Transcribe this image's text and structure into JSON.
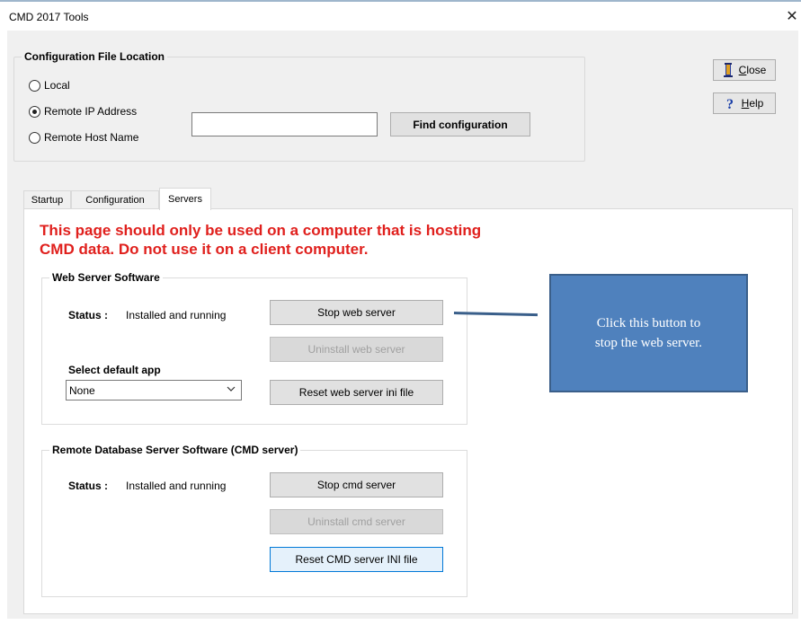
{
  "window": {
    "title": "CMD 2017 Tools",
    "close_glyph": "✕"
  },
  "config": {
    "group_title": "Configuration File Location",
    "options": [
      {
        "label": "Local",
        "checked": false
      },
      {
        "label": "Remote IP Address",
        "checked": true
      },
      {
        "label": "Remote Host Name",
        "checked": false
      }
    ],
    "address_value": "",
    "find_button": "Find configuration"
  },
  "side_buttons": {
    "close": {
      "label": "Close",
      "icon": "door-icon"
    },
    "help": {
      "label": "Help",
      "icon": "question-icon"
    }
  },
  "tabs": [
    {
      "label": "Startup",
      "active": false
    },
    {
      "label": "Configuration",
      "active": false
    },
    {
      "label": "Servers",
      "active": true
    }
  ],
  "servers": {
    "warning_line1": "This page should only be used on a computer that is hosting",
    "warning_line2": "CMD data. Do not use it on a client computer.",
    "web": {
      "group_title": "Web Server Software",
      "status_label": "Status :",
      "status_value": "Installed and running",
      "stop_button": "Stop web server",
      "uninstall_button": "Uninstall web server",
      "reset_button": "Reset web server ini file",
      "default_app_label": "Select default app",
      "default_app_value": "None"
    },
    "cmd": {
      "group_title": "Remote Database Server Software (CMD server)",
      "status_label": "Status :",
      "status_value": "Installed and running",
      "stop_button": "Stop cmd server",
      "uninstall_button": "Uninstall cmd server",
      "reset_button": "Reset CMD server INI file"
    }
  },
  "callout": {
    "line1": "Click this button to",
    "line2": "stop the web server."
  },
  "colors": {
    "warning": "#e0201d",
    "callout_fill": "#4f81bd",
    "focus_border": "#0078d7"
  }
}
